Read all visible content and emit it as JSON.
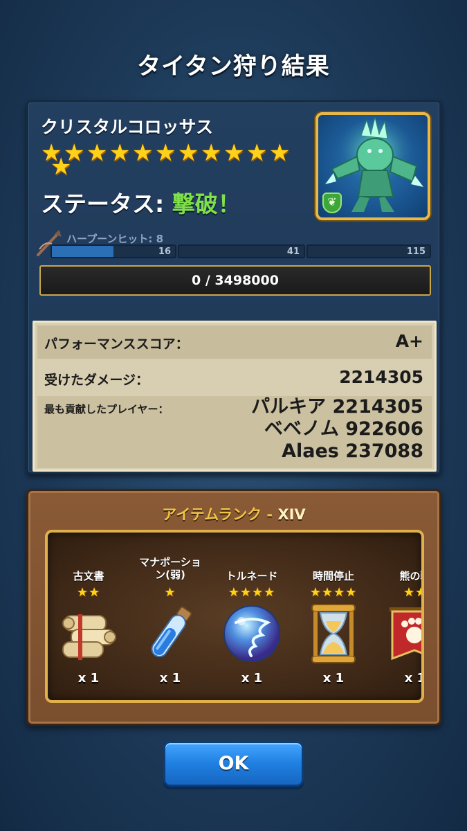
{
  "title": "タイタン狩り結果",
  "titan": {
    "name": "クリスタルコロッサス",
    "star_count": 12,
    "status_label": "ステータス:",
    "status_value": "撃破！",
    "element_icon": "leaf-icon"
  },
  "harpoon": {
    "label": "ハープーンヒット: 8",
    "segments": [
      {
        "value": "16",
        "fill": 0.5
      },
      {
        "value": "41",
        "fill": 0
      },
      {
        "value": "115",
        "fill": 0
      }
    ]
  },
  "hp": {
    "text": "0 / 3498000"
  },
  "results": {
    "score_label": "パフォーマンススコア：",
    "score_value": "A+",
    "damage_label": "受けたダメージ：",
    "damage_value": "2214305",
    "top_label": "最も貢献したプレイヤー：",
    "top_players": [
      "パルキア 2214305",
      "ベベノム 922606",
      "Alaes 237088"
    ]
  },
  "rewards": {
    "title_prefix": "アイテムランク - ",
    "title_rank": "XIV",
    "items": [
      {
        "name": "古文書",
        "stars": "★★",
        "qty": "x 1",
        "icon": "scroll-icon"
      },
      {
        "name": "マナポーション(弱)",
        "name_line1": "マナポーショ",
        "name_line2": "ン(弱)",
        "stars": "★",
        "qty": "x 1",
        "icon": "potion-icon"
      },
      {
        "name": "トルネード",
        "stars": "★★★★",
        "qty": "x 1",
        "icon": "tornado-orb-icon"
      },
      {
        "name": "時間停止",
        "stars": "★★★★",
        "qty": "x 1",
        "icon": "hourglass-icon"
      },
      {
        "name": "熊の戦",
        "stars": "★★",
        "qty": "x 1",
        "icon": "bear-banner-icon"
      }
    ]
  },
  "ok_label": "OK",
  "colors": {
    "background": "#1d3a59",
    "status_green": "#7fe04a",
    "gold": "#e0b04a",
    "button_blue": "#1f7fe0"
  }
}
